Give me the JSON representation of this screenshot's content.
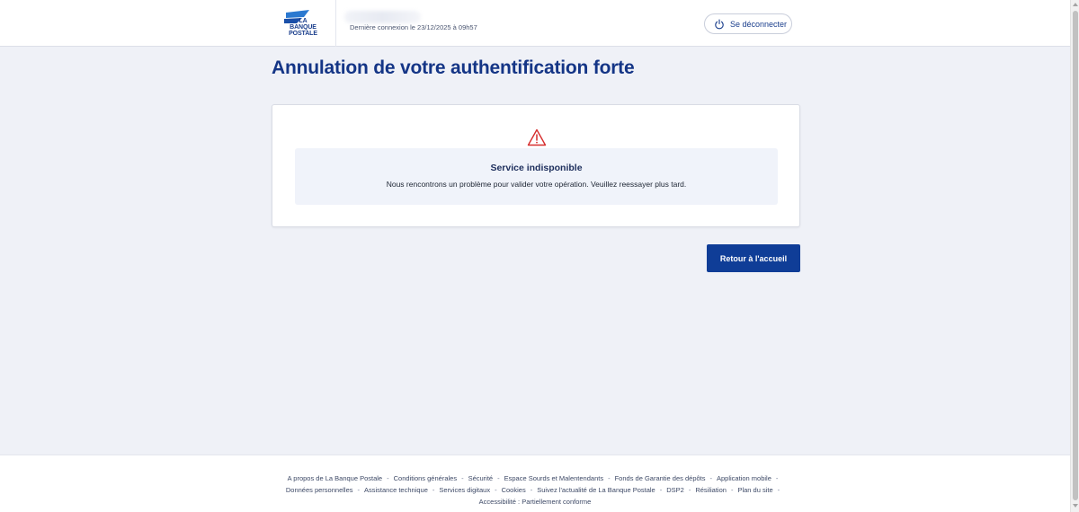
{
  "header": {
    "logo_lines": [
      "LA",
      "BANQUE",
      "POSTALE"
    ],
    "last_login": "Dernière connexion le 23/12/2025 à 09h57",
    "logout_label": "Se déconnecter",
    "logout_icon": "power-icon"
  },
  "main": {
    "title": "Annulation de votre authentification forte",
    "warning_icon": "warning-triangle-icon",
    "notice_title": "Service indisponible",
    "notice_text": "Nous rencontrons un problème pour valider votre opération. Veuillez reessayer plus tard.",
    "home_button": "Retour à l'accueil"
  },
  "footer": {
    "line1": [
      "A propos de La Banque Postale",
      "Conditions générales",
      "Sécurité",
      "Espace Sourds et Malentendants",
      "Fonds de Garantie des dépôts",
      "Application mobile"
    ],
    "line2": [
      "Données personnelles",
      "Assistance technique",
      "Services digitaux",
      "Cookies",
      "Suivez l'actualité de La Banque Postale",
      "DSP2",
      "Résiliation",
      "Plan du site"
    ],
    "line3": [
      "Accessibilité : Partiellement conforme"
    ]
  },
  "colors": {
    "brand_blue": "#143586",
    "button_blue": "#0f3d97",
    "warning_red": "#d62d2d",
    "page_bg": "#eff1f7"
  }
}
